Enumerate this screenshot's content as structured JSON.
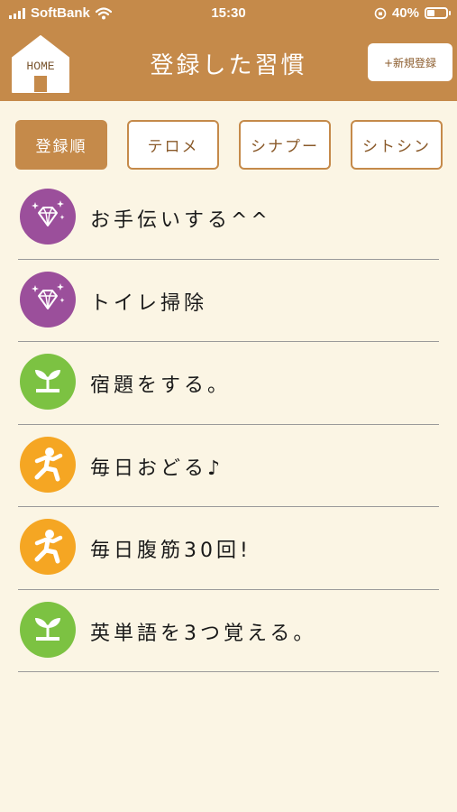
{
  "status_bar": {
    "carrier": "SoftBank",
    "time": "15:30",
    "battery": "40%",
    "battery_level": 0.4
  },
  "nav": {
    "home_label": "HOME",
    "title": "登録した習慣",
    "new_button": "+新規登録"
  },
  "sort_tabs": [
    {
      "label": "登録順",
      "active": true
    },
    {
      "label": "テロメ",
      "active": false
    },
    {
      "label": "シナプー",
      "active": false
    },
    {
      "label": "シトシン",
      "active": false
    }
  ],
  "habits": [
    {
      "name": "お手伝いする^^",
      "icon": "diamond-icon",
      "color": "#9B4F9B"
    },
    {
      "name": "トイレ掃除",
      "icon": "diamond-icon",
      "color": "#9B4F9B"
    },
    {
      "name": "宿題をする。",
      "icon": "sprout-icon",
      "color": "#7CC242"
    },
    {
      "name": "毎日おどる♪",
      "icon": "running-person-icon",
      "color": "#F5A623"
    },
    {
      "name": "毎日腹筋30回!",
      "icon": "running-person-icon",
      "color": "#F5A623"
    },
    {
      "name": "英単語を3つ覚える。",
      "icon": "sprout-icon",
      "color": "#7CC242"
    }
  ],
  "colors": {
    "header": "#C58A4A",
    "background": "#FBF5E4",
    "purple": "#9B4F9B",
    "green": "#7CC242",
    "orange": "#F5A623"
  }
}
